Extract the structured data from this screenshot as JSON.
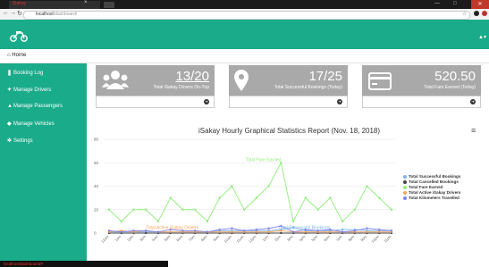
{
  "browser": {
    "tab_title": "iSakay",
    "address_host": "localhost",
    "address_path": "/dashboard/",
    "nav_icons": [
      "←",
      "→",
      "↻"
    ],
    "window_controls": [
      "—",
      "□",
      "✕"
    ]
  },
  "header": {
    "user_icon": "user-icon ▾"
  },
  "breadcrumb": {
    "home_label": "Home"
  },
  "sidebar": {
    "items": [
      {
        "icon": "book-icon",
        "glyph": "❚",
        "label": "Booking Log"
      },
      {
        "icon": "users-icon",
        "glyph": "✦",
        "label": "Manage Drivers"
      },
      {
        "icon": "user-icon",
        "glyph": "▲",
        "label": "Manage Passengers"
      },
      {
        "icon": "car-icon",
        "glyph": "◆",
        "label": "Manage Vehicles"
      },
      {
        "icon": "gears-icon",
        "glyph": "✲",
        "label": "Settings"
      }
    ]
  },
  "cards": [
    {
      "value": "13/20",
      "label": "Total iSakay Drivers On-Trip",
      "icon": "users-icon"
    },
    {
      "value": "17/25",
      "label": "Total Successful Bookings (Today)",
      "icon": "map-marker-icon"
    },
    {
      "value": "520.50",
      "label": "Total Fare Earned (Today)",
      "icon": "credit-card-icon"
    }
  ],
  "chart_data": {
    "type": "line",
    "title": "iSakay Hourly Graphical Statistics Report (Nov. 18, 2018)",
    "categories": [
      "12am",
      "1am",
      "2am",
      "3am",
      "4am",
      "5am",
      "6am",
      "7am",
      "8am",
      "9am",
      "10am",
      "11am",
      "12pm",
      "1pm",
      "2pm",
      "3pm",
      "4pm",
      "5pm",
      "6pm",
      "7pm",
      "8pm",
      "9pm",
      "10pm",
      "11pm"
    ],
    "ylim": [
      0,
      80
    ],
    "yticks": [
      0,
      20,
      40,
      60,
      80
    ],
    "grid": true,
    "legend_position": "right",
    "series": [
      {
        "name": "Total Successful Bookings",
        "color": "#7cb5ec",
        "values": [
          1,
          1,
          1,
          1,
          1,
          1,
          1,
          1,
          1,
          2,
          2,
          2,
          2,
          2,
          3,
          5,
          2,
          2,
          2,
          3,
          3,
          2,
          2,
          2
        ]
      },
      {
        "name": "Total Cancelled Bookings",
        "color": "#434348",
        "values": [
          0,
          0,
          0,
          0,
          0,
          0,
          0,
          0,
          0,
          0,
          0,
          0,
          0,
          0,
          0,
          0,
          0,
          0,
          0,
          0,
          0,
          0,
          0,
          0
        ]
      },
      {
        "name": "Total Fare Earned",
        "color": "#90ed7d",
        "values": [
          20,
          10,
          20,
          20,
          10,
          30,
          20,
          20,
          10,
          30,
          40,
          20,
          30,
          40,
          60,
          10,
          30,
          20,
          30,
          10,
          20,
          40,
          30,
          20
        ]
      },
      {
        "name": "Total Active iSakay Drivers",
        "color": "#f7a35c",
        "values": [
          1,
          2,
          1,
          2,
          1,
          1,
          1,
          1,
          1,
          1,
          1,
          1,
          1,
          1,
          2,
          1,
          1,
          1,
          1,
          1,
          1,
          1,
          1,
          1
        ]
      },
      {
        "name": "Total Kilometers Travelled",
        "color": "#8085e9",
        "values": [
          2,
          1,
          2,
          2,
          1,
          3,
          2,
          2,
          1,
          3,
          4,
          2,
          3,
          4,
          6,
          1,
          3,
          2,
          3,
          1,
          2,
          4,
          3,
          2
        ]
      }
    ],
    "annotations": [
      {
        "text": "Total Fare Earned",
        "series": 2,
        "index": 14,
        "color": "#90ed7d"
      },
      {
        "text": "Total Active iSakay Drivers",
        "series": 3,
        "index": 3,
        "color": "#f7a35c"
      },
      {
        "text": "Total Successful Bookings",
        "series": 0,
        "index": 18,
        "color": "#7cb5ec"
      }
    ]
  },
  "status_bar": {
    "text": "localhost/dashboard/#"
  }
}
